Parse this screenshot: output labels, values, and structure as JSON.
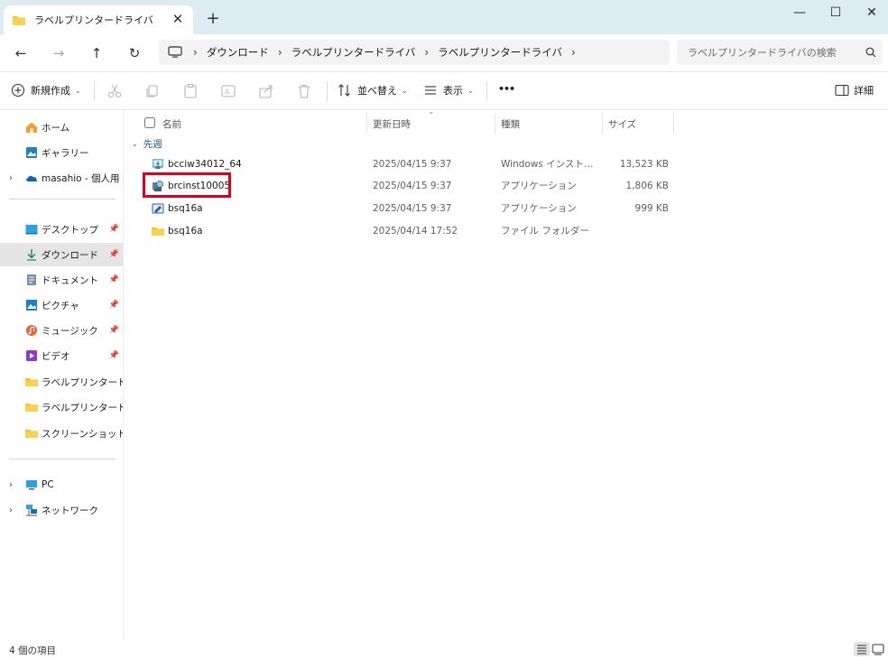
{
  "window": {
    "tab_title": "ラベルプリンタードライバ",
    "tab_close": "✕",
    "new_tab": "+",
    "minimize": "—",
    "maximize": "☐",
    "close": "✕"
  },
  "nav": {
    "back": "←",
    "forward": "→",
    "up": "↑",
    "refresh": "↻"
  },
  "address": {
    "separator": "›",
    "crumbs": [
      "ダウンロード",
      "ラベルプリンタードライバ",
      "ラベルプリンタードライバ"
    ],
    "trailing_chevron": "›"
  },
  "search": {
    "placeholder": "ラベルプリンタードライバの検索"
  },
  "commands": {
    "new": "新規作成",
    "sort": "並べ替え",
    "view": "表示",
    "more": "•••",
    "details": "詳細"
  },
  "sidebar": {
    "home": "ホーム",
    "gallery": "ギャラリー",
    "onedrive": "masahio - 個人用",
    "pinned": [
      {
        "label": "デスクトップ"
      },
      {
        "label": "ダウンロード"
      },
      {
        "label": "ドキュメント"
      },
      {
        "label": "ピクチャ"
      },
      {
        "label": "ミュージック"
      },
      {
        "label": "ビデオ"
      }
    ],
    "folders": [
      "ラベルプリンタードライバ",
      "ラベルプリンタードライバ",
      "スクリーンショット"
    ],
    "pc": "PC",
    "network": "ネットワーク"
  },
  "columns": {
    "name": "名前",
    "date": "更新日時",
    "type": "種類",
    "size": "サイズ"
  },
  "group_label": "先週",
  "files": [
    {
      "name": "bcciw34012_64",
      "date": "2025/04/15 9:37",
      "type": "Windows インストーラー...",
      "size": "13,523 KB",
      "icon": "installer-icon"
    },
    {
      "name": "brcinst10005",
      "date": "2025/04/15 9:37",
      "type": "アプリケーション",
      "size": "1,806 KB",
      "icon": "setup-app-icon"
    },
    {
      "name": "bsq16a",
      "date": "2025/04/15 9:37",
      "type": "アプリケーション",
      "size": "999 KB",
      "icon": "app-icon"
    },
    {
      "name": "bsq16a",
      "date": "2025/04/14 17:52",
      "type": "ファイル フォルダー",
      "size": "",
      "icon": "folder-icon"
    }
  ],
  "status": {
    "item_count": "4 個の項目"
  },
  "colors": {
    "titlebar": "#dcecf1",
    "folder": "#f4c430",
    "accent": "#0067c0",
    "highlight": "#e0001b"
  }
}
